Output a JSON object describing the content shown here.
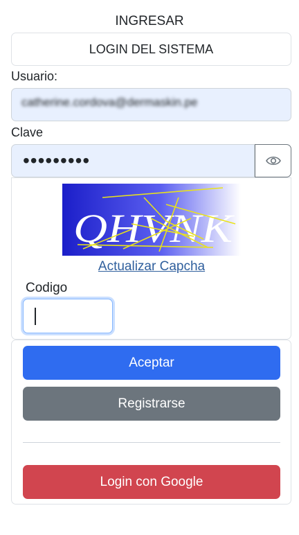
{
  "header": {
    "title": "INGRESAR",
    "system_label": "LOGIN DEL SISTEMA"
  },
  "form": {
    "user_label": "Usuario:",
    "user_value": "catherine.cordova@dermaskin.pe",
    "password_label": "Clave",
    "password_value": "•••••••••",
    "show_password_icon": "eye-icon",
    "captcha_text": "QHVNK",
    "refresh_captcha_label": "Actualizar Capcha",
    "code_label": "Codigo",
    "code_value": ""
  },
  "actions": {
    "accept_label": "Aceptar",
    "register_label": "Registrarse",
    "google_label": "Login con Google"
  },
  "colors": {
    "accept": "#2f6cf0",
    "register": "#6c757d",
    "google": "#d1454f",
    "autofill": "#e8f0fe",
    "link": "#2f5f9d"
  }
}
